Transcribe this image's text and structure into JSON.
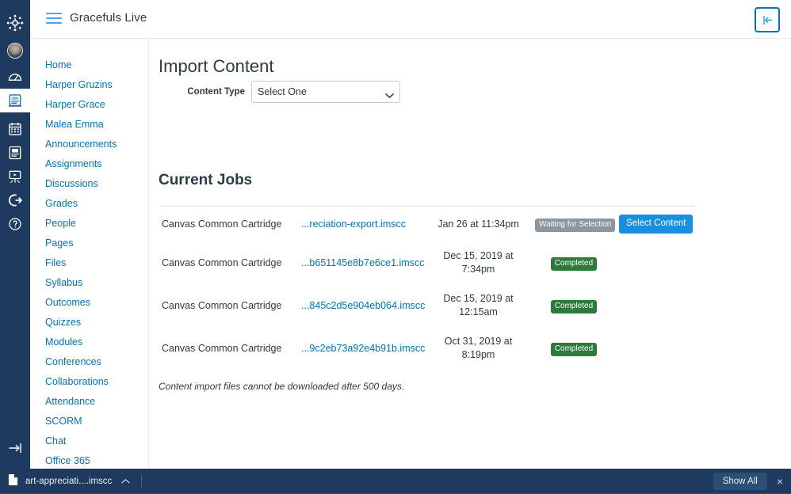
{
  "global_nav": {
    "items": [
      {
        "name": "canvas-logo-icon",
        "label": "Canvas"
      },
      {
        "name": "account-avatar",
        "label": "Account"
      },
      {
        "name": "dashboard-icon",
        "label": "Dashboard"
      },
      {
        "name": "courses-icon",
        "label": "Courses",
        "active": true
      },
      {
        "name": "calendar-icon",
        "label": "Calendar"
      },
      {
        "name": "inbox-icon",
        "label": "Inbox"
      },
      {
        "name": "studio-icon",
        "label": "Studio"
      },
      {
        "name": "commons-icon",
        "label": "Commons"
      },
      {
        "name": "help-icon",
        "label": "Help"
      }
    ],
    "bottom_item": {
      "name": "expand-nav-icon",
      "label": "Expand global navigation"
    }
  },
  "header": {
    "menu_label": "Menu",
    "course_title": "Gracefuls Live",
    "collapse_label": "Collapse course navigation"
  },
  "course_nav": {
    "items": [
      {
        "label": "Home"
      },
      {
        "label": "Harper Gruzins"
      },
      {
        "label": "Harper Grace"
      },
      {
        "label": "Malea Emma"
      },
      {
        "label": "Announcements"
      },
      {
        "label": "Assignments"
      },
      {
        "label": "Discussions"
      },
      {
        "label": "Grades"
      },
      {
        "label": "People"
      },
      {
        "label": "Pages"
      },
      {
        "label": "Files"
      },
      {
        "label": "Syllabus"
      },
      {
        "label": "Outcomes"
      },
      {
        "label": "Quizzes"
      },
      {
        "label": "Modules"
      },
      {
        "label": "Conferences"
      },
      {
        "label": "Collaborations"
      },
      {
        "label": "Attendance"
      },
      {
        "label": "SCORM"
      },
      {
        "label": "Chat"
      },
      {
        "label": "Office 365"
      }
    ]
  },
  "main": {
    "page_title": "Import Content",
    "content_type": {
      "label": "Content Type",
      "value": "Select One",
      "options": [
        "Select One"
      ]
    },
    "jobs": {
      "title": "Current Jobs",
      "rows": [
        {
          "type": "Canvas Common Cartridge",
          "file": "...reciation-export.imscc",
          "date": "Jan 26 at 11:34pm",
          "status": "Waiting for Selection",
          "status_kind": "waiting",
          "action": "Select Content"
        },
        {
          "type": "Canvas Common Cartridge",
          "file": "...b651145e8b7e6ce1.imscc",
          "date": "Dec 15, 2019 at 7:34pm",
          "status": "Completed",
          "status_kind": "completed",
          "action": ""
        },
        {
          "type": "Canvas Common Cartridge",
          "file": "...845c2d5e904eb064.imscc",
          "date": "Dec 15, 2019 at 12:15am",
          "status": "Completed",
          "status_kind": "completed",
          "action": ""
        },
        {
          "type": "Canvas Common Cartridge",
          "file": "...9c2eb73a92e4b91b.imscc",
          "date": "Oct 31, 2019 at 8:19pm",
          "status": "Completed",
          "status_kind": "completed",
          "action": ""
        }
      ],
      "note": "Content import files cannot be downloaded after 500 days."
    }
  },
  "download_shelf": {
    "filename": "art-appreciati....imscc",
    "caret_label": "Open download menu",
    "show_all_label": "Show All",
    "close_label": "×"
  },
  "colors": {
    "nav_navy": "#1E3A5F",
    "link_blue": "#0374B5",
    "accent_blue": "#1790DF",
    "badge_gray": "#8B969E",
    "badge_green": "#2D7B3A",
    "text": "#2D3B45"
  }
}
